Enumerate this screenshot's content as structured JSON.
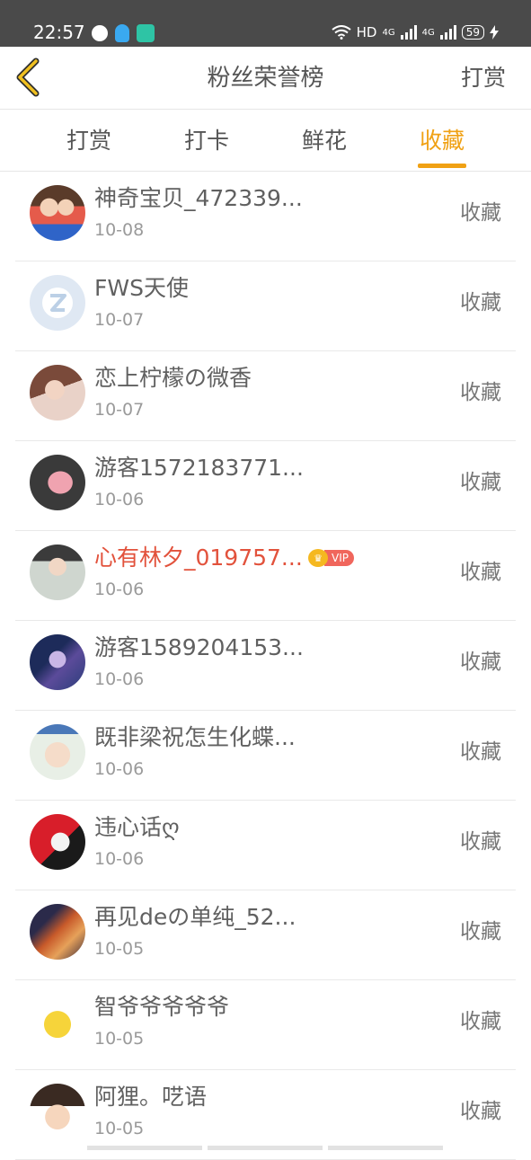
{
  "status_bar": {
    "time": "22:57",
    "right_text": "HD",
    "network": "4G",
    "network2": "4G",
    "battery": "59"
  },
  "header": {
    "back_icon": "chevron-left-icon",
    "title": "粉丝荣誉榜",
    "right_action": "打赏"
  },
  "tabs": [
    {
      "label": "打赏"
    },
    {
      "label": "打卡"
    },
    {
      "label": "鲜花"
    },
    {
      "label": "收藏",
      "active": true
    }
  ],
  "accent_color": "#f0a114",
  "vip_color": "#e2523c",
  "fans": [
    {
      "name": "神奇宝贝_472339...",
      "date": "10-08",
      "action": "收藏"
    },
    {
      "name": "FWS天使",
      "date": "10-07",
      "action": "收藏"
    },
    {
      "name": "恋上柠檬の微香",
      "date": "10-07",
      "action": "收藏"
    },
    {
      "name": "游客1572183771...",
      "date": "10-06",
      "action": "收藏"
    },
    {
      "name": "心有林夕_019757...",
      "date": "10-06",
      "action": "收藏",
      "vip": "VIP"
    },
    {
      "name": "游客1589204153...",
      "date": "10-06",
      "action": "收藏"
    },
    {
      "name": "既非梁祝怎生化蝶...",
      "date": "10-06",
      "action": "收藏"
    },
    {
      "name": "违心话ღ",
      "date": "10-06",
      "action": "收藏"
    },
    {
      "name": "再见deの单纯_52...",
      "date": "10-05",
      "action": "收藏"
    },
    {
      "name": "智爷爷爷爷爷",
      "date": "10-05",
      "action": "收藏"
    },
    {
      "name": "阿狸。呓语",
      "date": "10-05",
      "action": "收藏"
    }
  ]
}
